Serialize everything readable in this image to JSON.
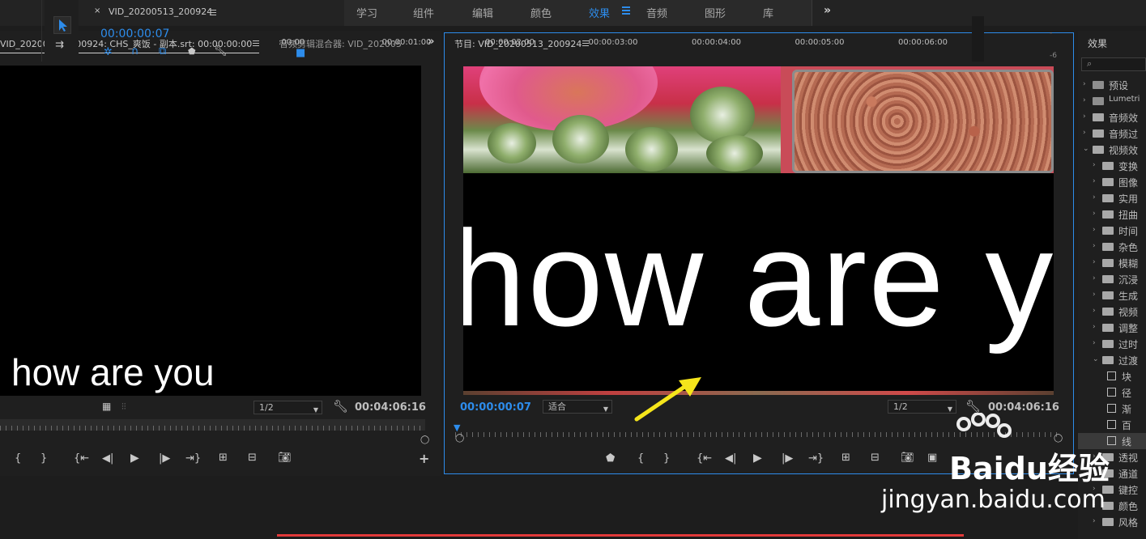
{
  "workspaces": {
    "tabs": [
      "学习",
      "组件",
      "编辑",
      "颜色",
      "效果",
      "音频",
      "图形",
      "库"
    ],
    "active": "效果",
    "more": "»"
  },
  "source_panel": {
    "tab_title": "VID_20200513_200924:  CHS_爽饭 - 副本.srt: 00:00:00:00",
    "tab2_title": "音频剪辑混合器: VID_202005",
    "more": "»",
    "caption": "how are you",
    "resolution": "1/2",
    "duration": "00:04:06:16"
  },
  "program_panel": {
    "tab_title": "节目: VID_20200513_200924",
    "caption": "how are y",
    "current_time": "00:00:00:07",
    "fit": "适合",
    "resolution": "1/2",
    "duration": "00:04:06:16"
  },
  "effects_panel": {
    "title": "效果",
    "items": [
      {
        "label": "预设",
        "level": 0,
        "type": "folder-special"
      },
      {
        "label": "Lumetri",
        "level": 0,
        "type": "folder-special"
      },
      {
        "label": "音频效",
        "level": 0,
        "type": "folder"
      },
      {
        "label": "音频过",
        "level": 0,
        "type": "folder"
      },
      {
        "label": "视频效",
        "level": 0,
        "type": "folder",
        "open": true
      },
      {
        "label": "变换",
        "level": 1,
        "type": "folder"
      },
      {
        "label": "图像",
        "level": 1,
        "type": "folder"
      },
      {
        "label": "实用",
        "level": 1,
        "type": "folder"
      },
      {
        "label": "扭曲",
        "level": 1,
        "type": "folder"
      },
      {
        "label": "时间",
        "level": 1,
        "type": "folder"
      },
      {
        "label": "杂色",
        "level": 1,
        "type": "folder"
      },
      {
        "label": "模糊",
        "level": 1,
        "type": "folder"
      },
      {
        "label": "沉浸",
        "level": 1,
        "type": "folder"
      },
      {
        "label": "生成",
        "level": 1,
        "type": "folder"
      },
      {
        "label": "视频",
        "level": 1,
        "type": "folder"
      },
      {
        "label": "调整",
        "level": 1,
        "type": "folder"
      },
      {
        "label": "过时",
        "level": 1,
        "type": "folder"
      },
      {
        "label": "过渡",
        "level": 1,
        "type": "folder",
        "open": true
      },
      {
        "label": "块",
        "level": 2,
        "type": "effect"
      },
      {
        "label": "径",
        "level": 2,
        "type": "effect"
      },
      {
        "label": "渐",
        "level": 2,
        "type": "effect"
      },
      {
        "label": "百",
        "level": 2,
        "type": "effect"
      },
      {
        "label": "线",
        "level": 2,
        "type": "effect",
        "selected": true
      },
      {
        "label": "透视",
        "level": 1,
        "type": "folder"
      },
      {
        "label": "通道",
        "level": 1,
        "type": "folder"
      },
      {
        "label": "键控",
        "level": 1,
        "type": "folder"
      },
      {
        "label": "颜色",
        "level": 1,
        "type": "folder"
      },
      {
        "label": "风格",
        "level": 1,
        "type": "folder"
      }
    ]
  },
  "timeline": {
    "sequence_name": "VID_20200513_200924",
    "current_time": "00:00:00:07",
    "ruler_labels": [
      ":00:00",
      "00:00:01:00",
      "00:00:02:00",
      "00:00:03:00",
      "00:00:04:00",
      "00:00:05:00",
      "00:00:06:00"
    ]
  },
  "watermark": {
    "brand": "Baidu",
    "text": "经验",
    "url": "jingyan.baidu.com"
  },
  "colors": {
    "accent": "#2d8ceb",
    "arrow": "#f5e51b",
    "bar_red": "#e23a3a"
  }
}
